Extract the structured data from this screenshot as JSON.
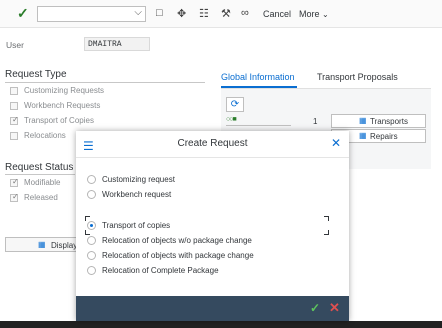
{
  "toolbar": {
    "confirm_icon": "checkmark-icon",
    "cancel_label": "Cancel",
    "more_label": "More",
    "icons": [
      "document-icon",
      "hierarchy-icon",
      "filter-icon",
      "tools-icon",
      "glasses-icon"
    ]
  },
  "form": {
    "user_label": "User",
    "user_value": "DMAITRA",
    "request_type_title": "Request Type",
    "request_types": [
      {
        "label": "Customizing Requests",
        "checked": false
      },
      {
        "label": "Workbench Requests",
        "checked": false
      },
      {
        "label": "Transport of Copies",
        "checked": true
      },
      {
        "label": "Relocations",
        "checked": false
      }
    ],
    "request_status_title": "Request Status",
    "request_statuses": [
      {
        "label": "Modifiable",
        "checked": true
      },
      {
        "label": "Released",
        "checked": true
      }
    ],
    "display_label": "Display"
  },
  "tabs": {
    "global_label": "Global Information",
    "transport_label": "Transport Proposals"
  },
  "panel": {
    "count": "1",
    "transports_label": "Transports",
    "repairs_label": "Repairs"
  },
  "dialog": {
    "title": "Create Request",
    "options": [
      {
        "label": "Customizing request",
        "selected": false
      },
      {
        "label": "Workbench request",
        "selected": false
      },
      {
        "label": "Transport of copies",
        "selected": true
      },
      {
        "label": "Relocation of objects w/o package change",
        "selected": false
      },
      {
        "label": "Relocation of objects with package change",
        "selected": false
      },
      {
        "label": "Relocation of Complete Package",
        "selected": false
      }
    ]
  },
  "colors": {
    "accent": "#0a6ed1",
    "footer": "#354a5f",
    "ok": "#5dc45d",
    "cancel": "#e05050"
  }
}
